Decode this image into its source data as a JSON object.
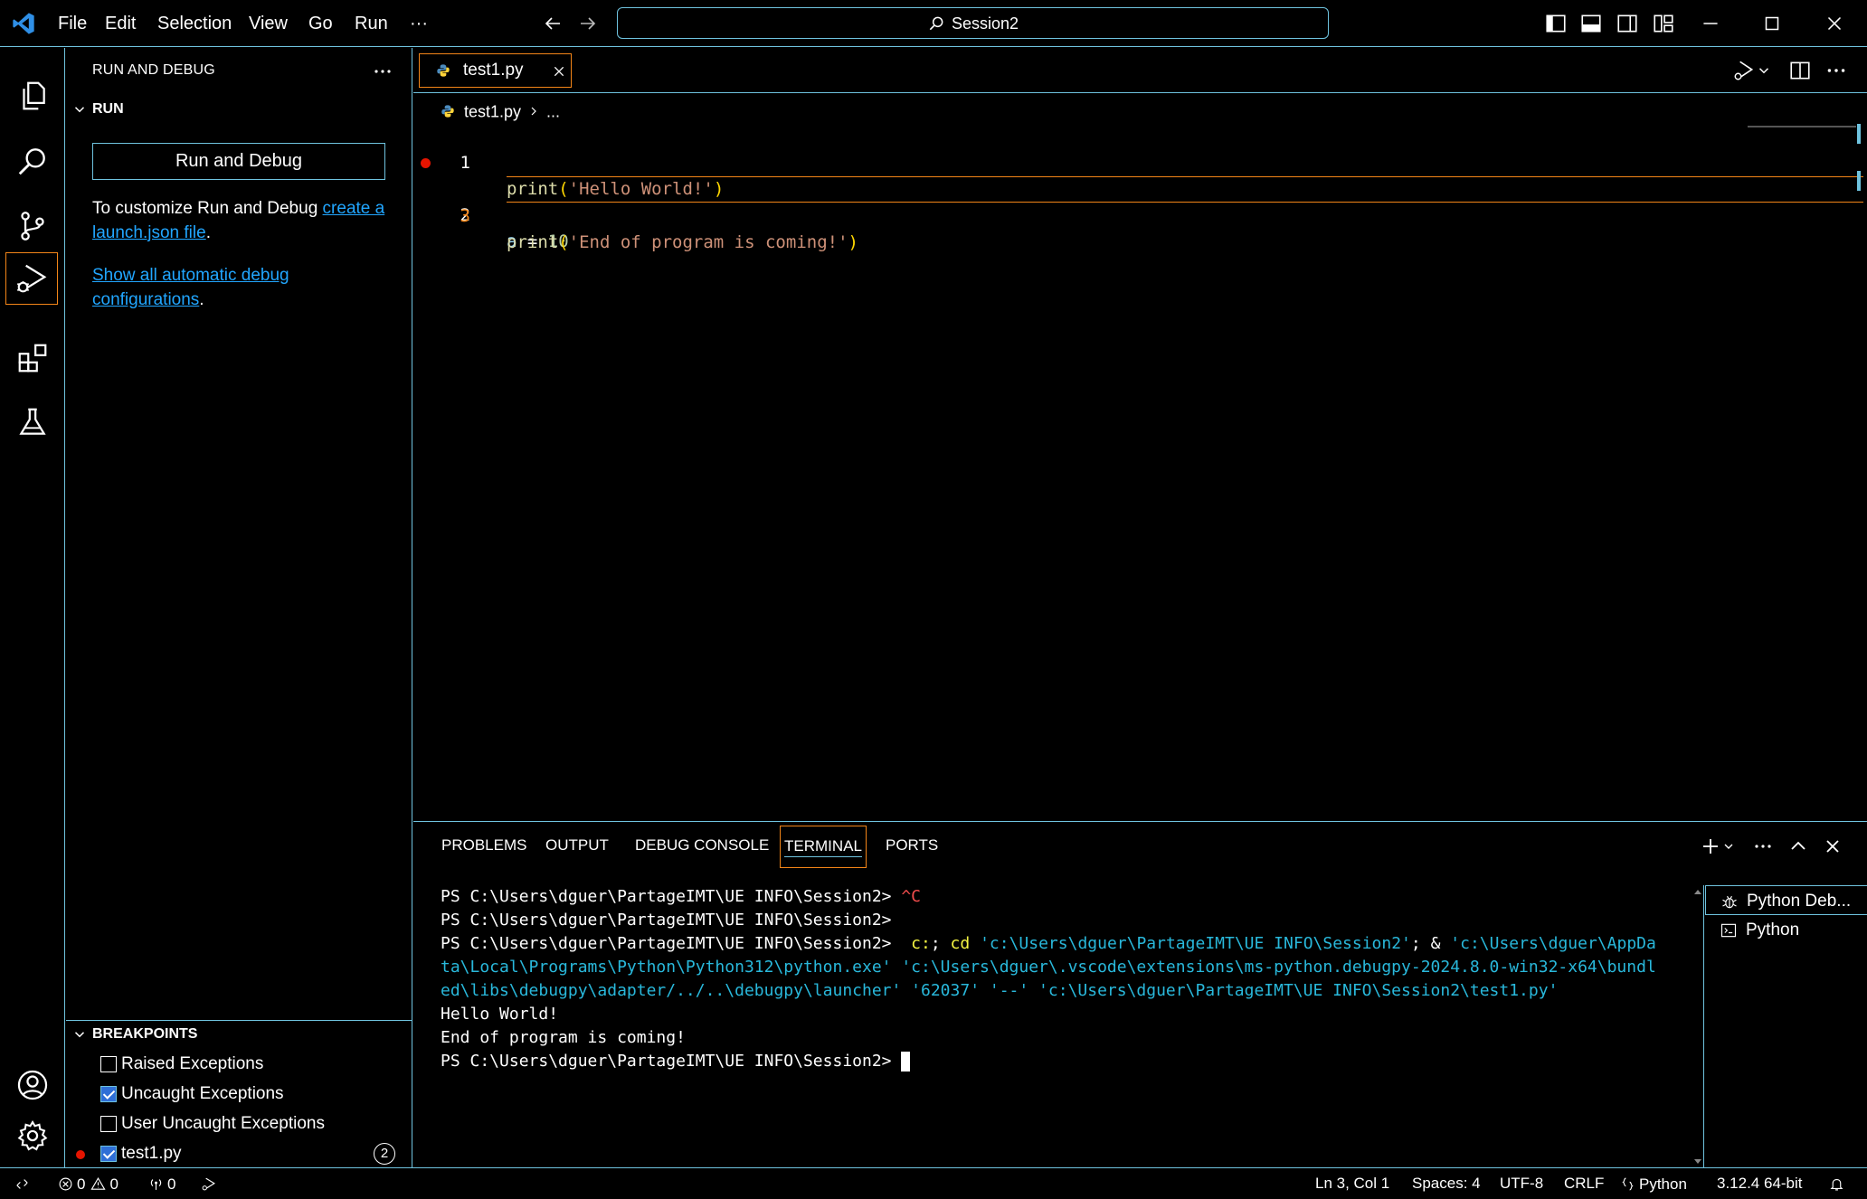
{
  "titlebar": {
    "menu": [
      "File",
      "Edit",
      "Selection",
      "View",
      "Go",
      "Run"
    ],
    "more": "···",
    "search": "Session2"
  },
  "sidebar": {
    "title": "RUN AND DEBUG",
    "run_section": "RUN",
    "run_button": "Run and Debug",
    "customize_text": "To customize Run and Debug ",
    "customize_link": "create a launch.json file",
    "period": ".",
    "show_all_link": "Show all automatic debug configurations",
    "breakpoints_section": "BREAKPOINTS",
    "breakpoints": [
      {
        "label": "Raised Exceptions",
        "checked": false
      },
      {
        "label": "Uncaught Exceptions",
        "checked": true
      },
      {
        "label": "User Uncaught Exceptions",
        "checked": false
      },
      {
        "label": "test1.py",
        "checked": true,
        "count": "2"
      }
    ]
  },
  "editor": {
    "tab": "test1.py",
    "breadcrumb_file": "test1.py",
    "breadcrumb_more": "...",
    "lines": [
      {
        "n": "1",
        "fn": "print",
        "open": "(",
        "str": "'Hello World!'",
        "close": ")"
      },
      {
        "n": "2",
        "var": "a",
        "op": " = ",
        "num": "10"
      },
      {
        "n": "3",
        "fn": "print",
        "open": "(",
        "str": "'End of program is coming!'",
        "close": ")"
      }
    ]
  },
  "panel": {
    "tabs": [
      "PROBLEMS",
      "OUTPUT",
      "DEBUG CONSOLE",
      "TERMINAL",
      "PORTS"
    ],
    "terminal": {
      "prompt": "PS C:\\Users\\dguer\\PartageIMT\\UE INFO\\Session2> ",
      "ctrl_c": "^C",
      "cmd_c": " c:",
      "cmd_sep": "; ",
      "cmd_cd": "cd",
      "cmd_path": " 'c:\\Users\\dguer\\PartageIMT\\UE INFO\\Session2'",
      "cmd_amp": "; & ",
      "cmd_py_1": "'c:\\Users\\dguer\\AppDa",
      "wrap_2": "ta\\Local\\Programs\\Python\\Python312\\python.exe' 'c:\\Users\\dguer\\.vscode\\extensions\\ms-python.debugpy-2024.8.0-win32-x64\\bundl",
      "wrap_3": "ed\\libs\\debugpy\\adapter/../..\\debugpy\\launcher' '62037' '--' 'c:\\Users\\dguer\\PartageIMT\\UE INFO\\Session2\\test1.py'",
      "out_1": "Hello World!",
      "out_2": "End of program is coming!"
    },
    "terminal_list": [
      "Python Deb...",
      "Python"
    ]
  },
  "statusbar": {
    "errors": "0",
    "warnings": "0",
    "ports": "0",
    "position": "Ln 3, Col 1",
    "spaces": "Spaces: 4",
    "encoding": "UTF-8",
    "eol": "CRLF",
    "language": "Python",
    "interpreter": "3.12.4 64-bit"
  },
  "colors": {
    "border": "#6fc3df",
    "active_border": "#f38518",
    "link": "#21a6ff",
    "breakpoint": "#e51400"
  }
}
